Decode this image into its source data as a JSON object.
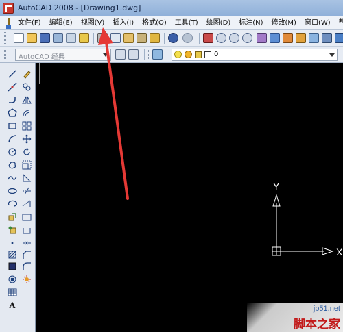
{
  "window": {
    "title": "AutoCAD 2008 - [Drawing1.dwg]"
  },
  "menu": {
    "items": [
      {
        "label": "文件(F)"
      },
      {
        "label": "编辑(E)"
      },
      {
        "label": "视图(V)"
      },
      {
        "label": "插入(I)"
      },
      {
        "label": "格式(O)"
      },
      {
        "label": "工具(T)"
      },
      {
        "label": "绘图(D)"
      },
      {
        "label": "标注(N)"
      },
      {
        "label": "修改(M)"
      },
      {
        "label": "窗口(W)"
      },
      {
        "label": "帮"
      }
    ]
  },
  "workspace": {
    "combo_value": "AutoCAD 经典"
  },
  "layer": {
    "current": "0"
  },
  "ucs": {
    "x_label": "X",
    "y_label": "Y"
  },
  "watermark": {
    "url": "jb51.net",
    "name": "脚本之家"
  },
  "colors": {
    "canvas_bg": "#000000",
    "crosshair": "#b81c1c",
    "annotation_arrow": "#e53935",
    "ucs_icon": "#ffffff"
  }
}
